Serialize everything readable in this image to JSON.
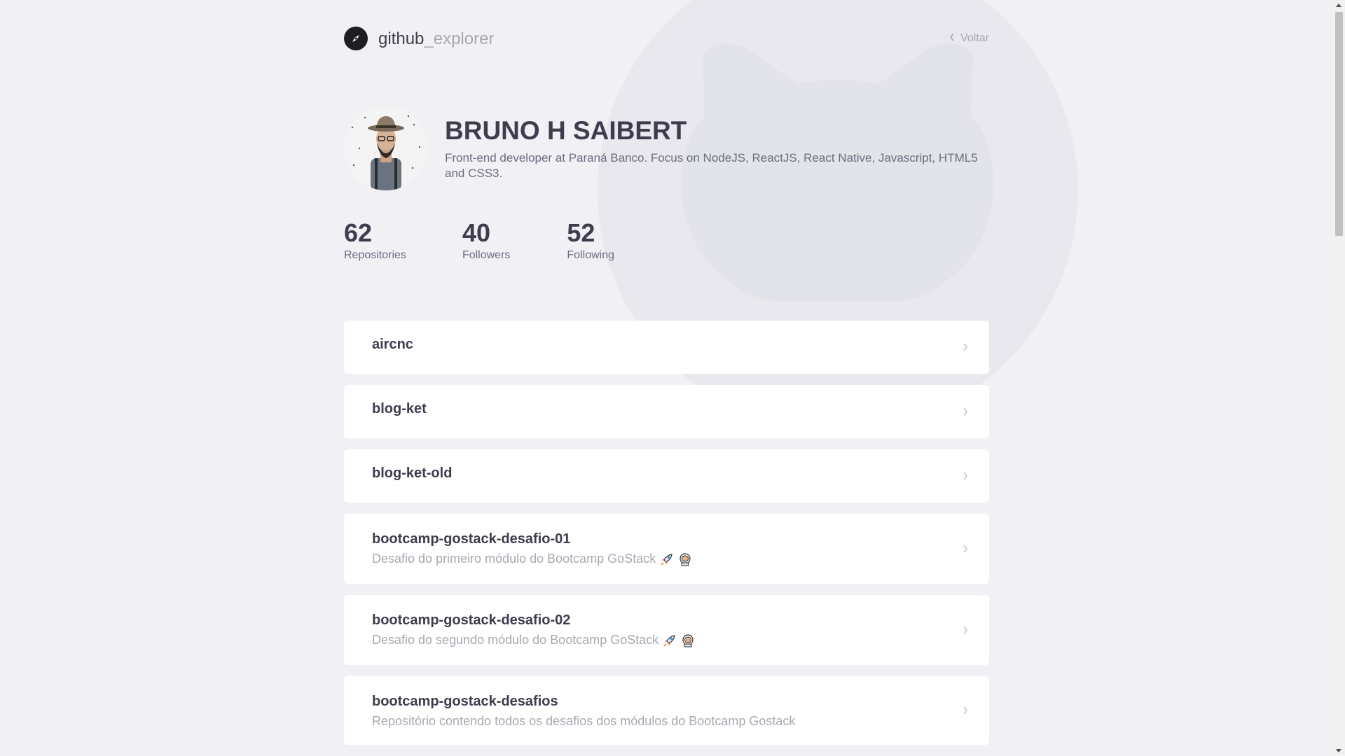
{
  "header": {
    "logo_strong": "github",
    "logo_light": "_explorer",
    "back_label": "Voltar",
    "logo_icon": "compass-icon",
    "back_icon": "chevron-left-icon"
  },
  "profile": {
    "name": "BRUNO H SAIBERT",
    "bio": "Front-end developer at Paraná Banco. Focus on NodeJS, ReactJS, React Native, Javascript, HTML5 and CSS3."
  },
  "stats": [
    {
      "value": "62",
      "label": "Repositories"
    },
    {
      "value": "40",
      "label": "Followers"
    },
    {
      "value": "52",
      "label": "Following"
    }
  ],
  "repos": [
    {
      "name": "aircnc",
      "description": ""
    },
    {
      "name": "blog-ket",
      "description": ""
    },
    {
      "name": "blog-ket-old",
      "description": ""
    },
    {
      "name": "bootcamp-gostack-desafio-01",
      "description": "Desafio do primeiro módulo do Bootcamp GoStack",
      "emojis": [
        "rocket-icon",
        "astronaut-icon"
      ]
    },
    {
      "name": "bootcamp-gostack-desafio-02",
      "description": "Desafio do segundo módulo do Bootcamp GoStack",
      "emojis": [
        "rocket-icon",
        "astronaut-icon"
      ]
    },
    {
      "name": "bootcamp-gostack-desafios",
      "description": "Repositório contendo todos os desafios dos módulos do Bootcamp Gostack"
    }
  ],
  "colors": {
    "background": "#f0f0f5",
    "card": "#ffffff",
    "title": "#3d3d4d",
    "muted": "#a8a8b3",
    "body_text": "#6c6c80"
  }
}
